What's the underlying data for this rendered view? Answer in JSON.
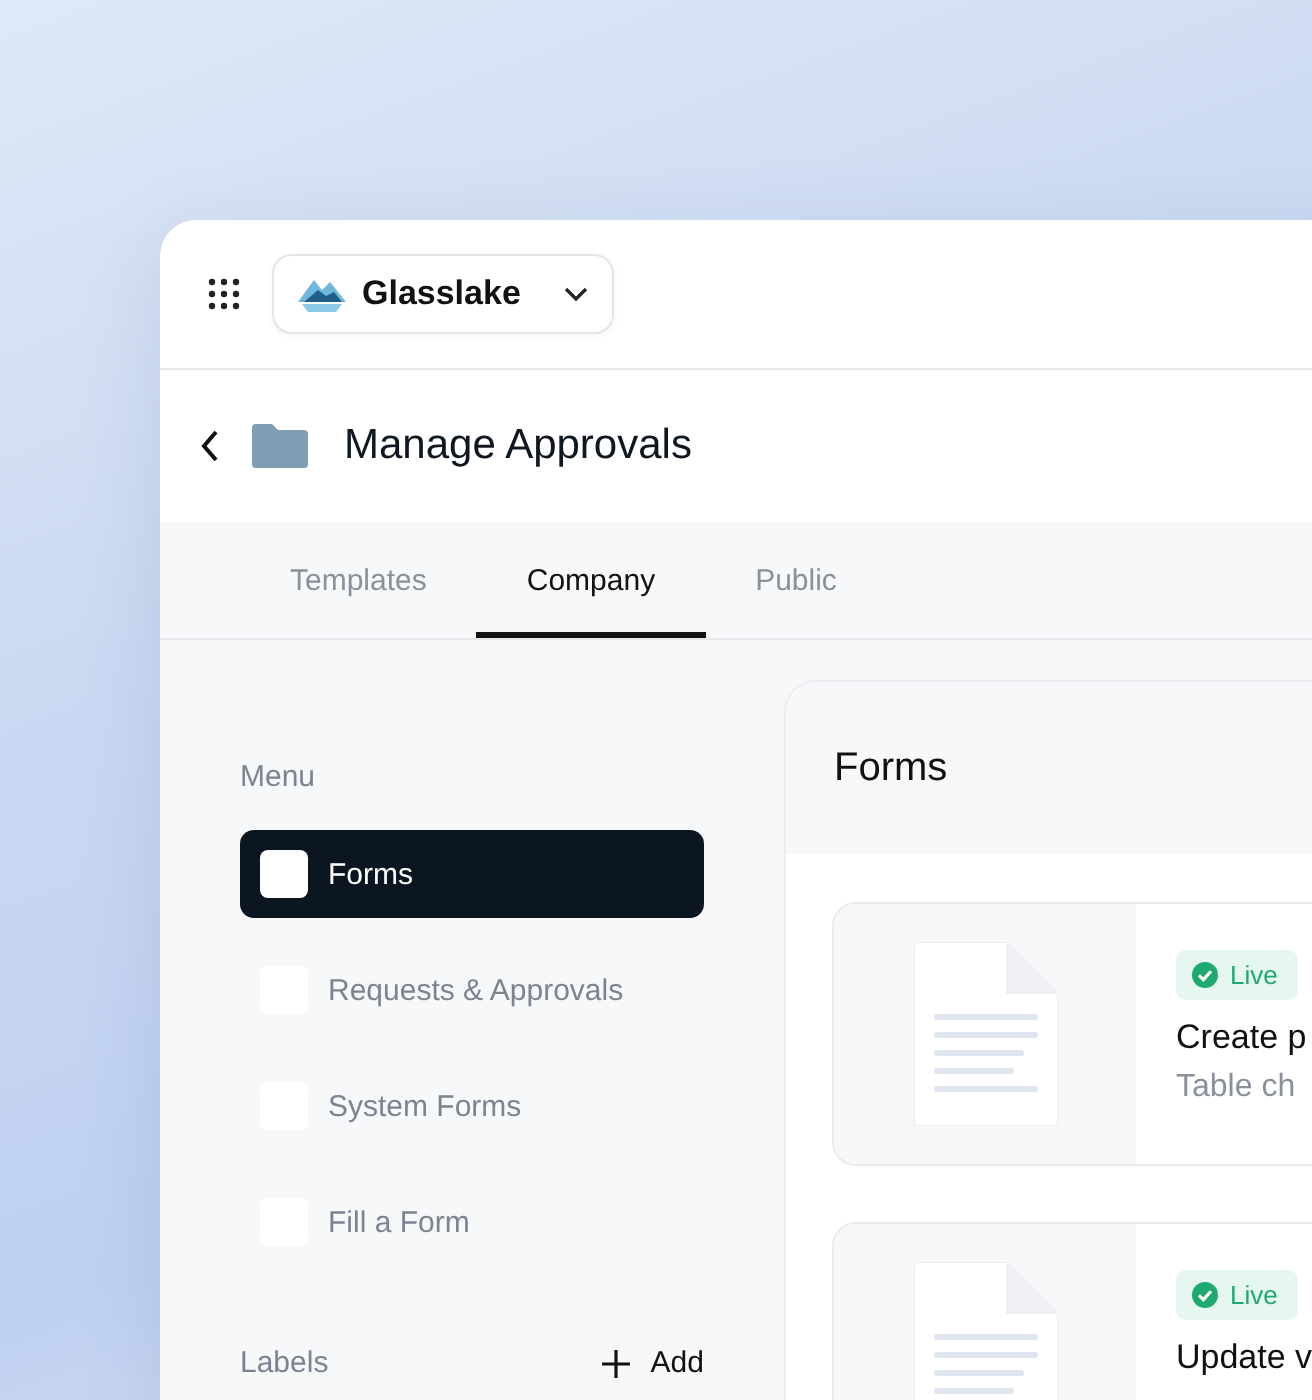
{
  "workspace": {
    "name": "Glasslake"
  },
  "header": {
    "title": "Manage Approvals"
  },
  "tabs": [
    {
      "label": "Templates",
      "selected": false
    },
    {
      "label": "Company",
      "selected": true
    },
    {
      "label": "Public",
      "selected": false
    }
  ],
  "sidebar": {
    "menu_title": "Menu",
    "items": [
      {
        "label": "Forms",
        "selected": true
      },
      {
        "label": "Requests & Approvals",
        "selected": false
      },
      {
        "label": "System Forms",
        "selected": false
      },
      {
        "label": "Fill a Form",
        "selected": false
      }
    ],
    "labels_title": "Labels",
    "add_label": "Add"
  },
  "panel": {
    "title": "Forms",
    "forms": [
      {
        "status": "Live",
        "title": "Create p",
        "subtitle": "Table ch"
      },
      {
        "status": "Live",
        "title": "Update v"
      }
    ]
  }
}
